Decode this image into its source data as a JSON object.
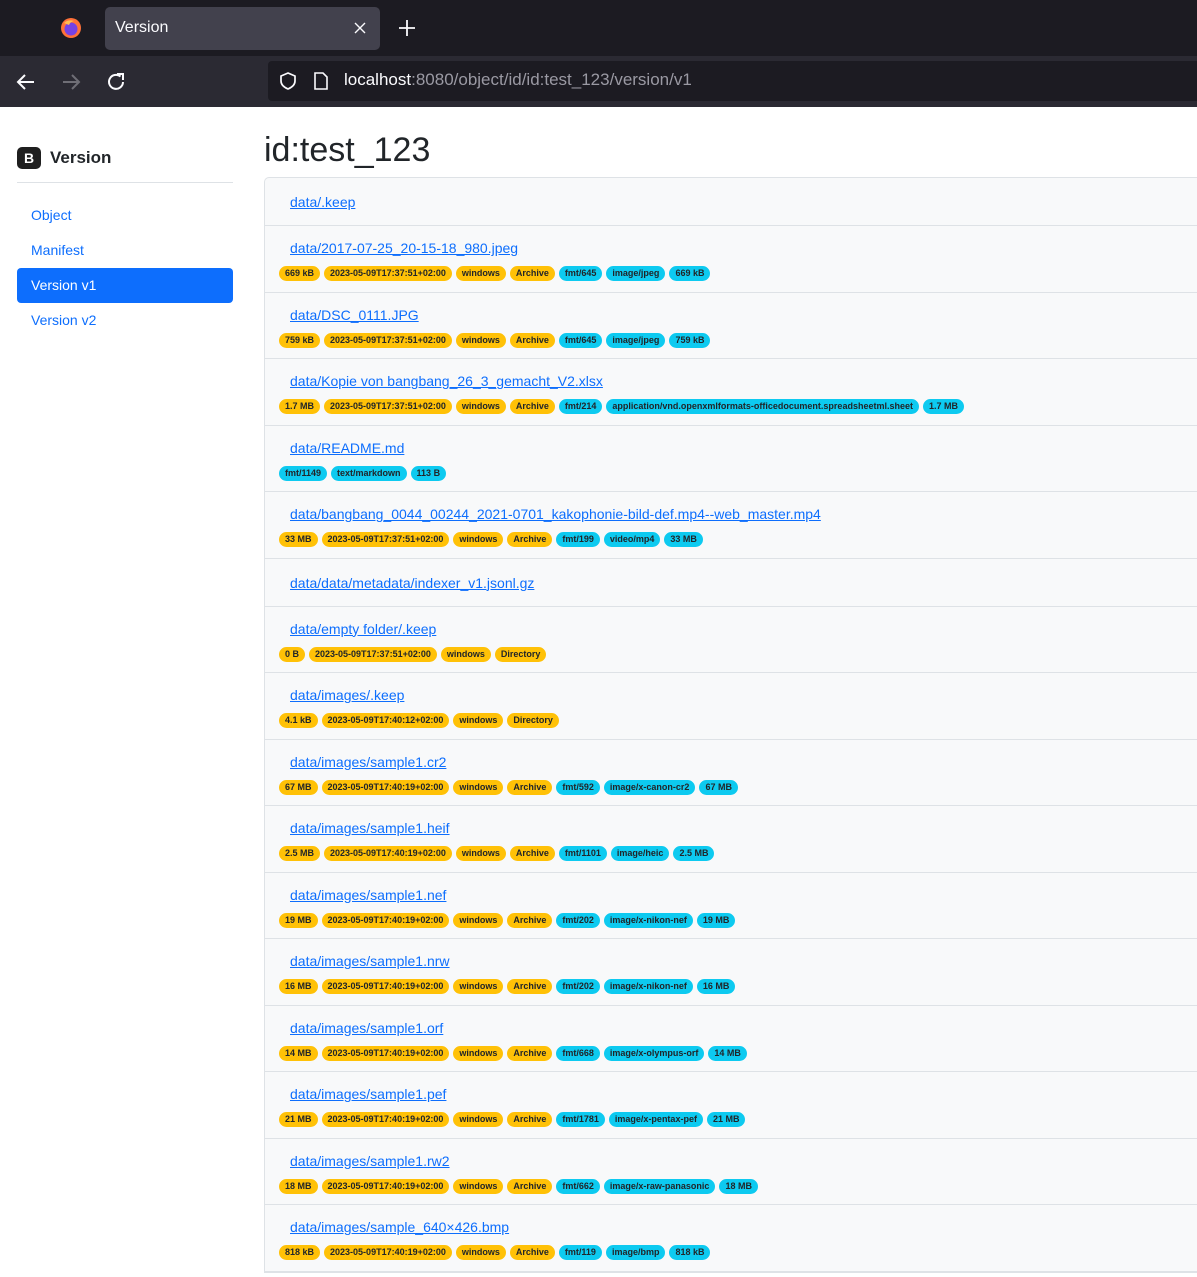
{
  "browser": {
    "tab_title": "Version",
    "url_host": "localhost",
    "url_path": ":8080/object/id/id:test_123/version/v1"
  },
  "sidebar": {
    "brand_letter": "B",
    "brand_title": "Version",
    "items": [
      {
        "label": "Object",
        "active": false
      },
      {
        "label": "Manifest",
        "active": false
      },
      {
        "label": "Version v1",
        "active": true
      },
      {
        "label": "Version v2",
        "active": false
      }
    ]
  },
  "main": {
    "title": "id:test_123",
    "files": [
      {
        "path": "data/.keep",
        "badges": []
      },
      {
        "path": "data/2017-07-25_20-15-18_980.jpeg",
        "badges": [
          {
            "text": "669 kB",
            "kind": "warn"
          },
          {
            "text": "2023-05-09T17:37:51+02:00",
            "kind": "warn"
          },
          {
            "text": "windows",
            "kind": "warn"
          },
          {
            "text": "Archive",
            "kind": "warn"
          },
          {
            "text": "fmt/645",
            "kind": "info"
          },
          {
            "text": "image/jpeg",
            "kind": "info"
          },
          {
            "text": "669 kB",
            "kind": "info"
          }
        ]
      },
      {
        "path": "data/DSC_0111.JPG",
        "badges": [
          {
            "text": "759 kB",
            "kind": "warn"
          },
          {
            "text": "2023-05-09T17:37:51+02:00",
            "kind": "warn"
          },
          {
            "text": "windows",
            "kind": "warn"
          },
          {
            "text": "Archive",
            "kind": "warn"
          },
          {
            "text": "fmt/645",
            "kind": "info"
          },
          {
            "text": "image/jpeg",
            "kind": "info"
          },
          {
            "text": "759 kB",
            "kind": "info"
          }
        ]
      },
      {
        "path": "data/Kopie von bangbang_26_3_gemacht_V2.xlsx",
        "badges": [
          {
            "text": "1.7 MB",
            "kind": "warn"
          },
          {
            "text": "2023-05-09T17:37:51+02:00",
            "kind": "warn"
          },
          {
            "text": "windows",
            "kind": "warn"
          },
          {
            "text": "Archive",
            "kind": "warn"
          },
          {
            "text": "fmt/214",
            "kind": "info"
          },
          {
            "text": "application/vnd.openxmlformats-officedocument.spreadsheetml.sheet",
            "kind": "info"
          },
          {
            "text": "1.7 MB",
            "kind": "info"
          }
        ]
      },
      {
        "path": "data/README.md",
        "badges": [
          {
            "text": "fmt/1149",
            "kind": "info"
          },
          {
            "text": "text/markdown",
            "kind": "info"
          },
          {
            "text": "113 B",
            "kind": "info"
          }
        ]
      },
      {
        "path": "data/bangbang_0044_00244_2021-0701_kakophonie-bild-def.mp4--web_master.mp4",
        "badges": [
          {
            "text": "33 MB",
            "kind": "warn"
          },
          {
            "text": "2023-05-09T17:37:51+02:00",
            "kind": "warn"
          },
          {
            "text": "windows",
            "kind": "warn"
          },
          {
            "text": "Archive",
            "kind": "warn"
          },
          {
            "text": "fmt/199",
            "kind": "info"
          },
          {
            "text": "video/mp4",
            "kind": "info"
          },
          {
            "text": "33 MB",
            "kind": "info"
          }
        ]
      },
      {
        "path": "data/data/metadata/indexer_v1.jsonl.gz",
        "badges": []
      },
      {
        "path": "data/empty folder/.keep",
        "badges": [
          {
            "text": "0 B",
            "kind": "warn"
          },
          {
            "text": "2023-05-09T17:37:51+02:00",
            "kind": "warn"
          },
          {
            "text": "windows",
            "kind": "warn"
          },
          {
            "text": "Directory",
            "kind": "warn"
          }
        ]
      },
      {
        "path": "data/images/.keep",
        "badges": [
          {
            "text": "4.1 kB",
            "kind": "warn"
          },
          {
            "text": "2023-05-09T17:40:12+02:00",
            "kind": "warn"
          },
          {
            "text": "windows",
            "kind": "warn"
          },
          {
            "text": "Directory",
            "kind": "warn"
          }
        ]
      },
      {
        "path": "data/images/sample1.cr2",
        "badges": [
          {
            "text": "67 MB",
            "kind": "warn"
          },
          {
            "text": "2023-05-09T17:40:19+02:00",
            "kind": "warn"
          },
          {
            "text": "windows",
            "kind": "warn"
          },
          {
            "text": "Archive",
            "kind": "warn"
          },
          {
            "text": "fmt/592",
            "kind": "info"
          },
          {
            "text": "image/x-canon-cr2",
            "kind": "info"
          },
          {
            "text": "67 MB",
            "kind": "info"
          }
        ]
      },
      {
        "path": "data/images/sample1.heif",
        "badges": [
          {
            "text": "2.5 MB",
            "kind": "warn"
          },
          {
            "text": "2023-05-09T17:40:19+02:00",
            "kind": "warn"
          },
          {
            "text": "windows",
            "kind": "warn"
          },
          {
            "text": "Archive",
            "kind": "warn"
          },
          {
            "text": "fmt/1101",
            "kind": "info"
          },
          {
            "text": "image/heic",
            "kind": "info"
          },
          {
            "text": "2.5 MB",
            "kind": "info"
          }
        ]
      },
      {
        "path": "data/images/sample1.nef",
        "badges": [
          {
            "text": "19 MB",
            "kind": "warn"
          },
          {
            "text": "2023-05-09T17:40:19+02:00",
            "kind": "warn"
          },
          {
            "text": "windows",
            "kind": "warn"
          },
          {
            "text": "Archive",
            "kind": "warn"
          },
          {
            "text": "fmt/202",
            "kind": "info"
          },
          {
            "text": "image/x-nikon-nef",
            "kind": "info"
          },
          {
            "text": "19 MB",
            "kind": "info"
          }
        ]
      },
      {
        "path": "data/images/sample1.nrw",
        "badges": [
          {
            "text": "16 MB",
            "kind": "warn"
          },
          {
            "text": "2023-05-09T17:40:19+02:00",
            "kind": "warn"
          },
          {
            "text": "windows",
            "kind": "warn"
          },
          {
            "text": "Archive",
            "kind": "warn"
          },
          {
            "text": "fmt/202",
            "kind": "info"
          },
          {
            "text": "image/x-nikon-nef",
            "kind": "info"
          },
          {
            "text": "16 MB",
            "kind": "info"
          }
        ]
      },
      {
        "path": "data/images/sample1.orf",
        "badges": [
          {
            "text": "14 MB",
            "kind": "warn"
          },
          {
            "text": "2023-05-09T17:40:19+02:00",
            "kind": "warn"
          },
          {
            "text": "windows",
            "kind": "warn"
          },
          {
            "text": "Archive",
            "kind": "warn"
          },
          {
            "text": "fmt/668",
            "kind": "info"
          },
          {
            "text": "image/x-olympus-orf",
            "kind": "info"
          },
          {
            "text": "14 MB",
            "kind": "info"
          }
        ]
      },
      {
        "path": "data/images/sample1.pef",
        "badges": [
          {
            "text": "21 MB",
            "kind": "warn"
          },
          {
            "text": "2023-05-09T17:40:19+02:00",
            "kind": "warn"
          },
          {
            "text": "windows",
            "kind": "warn"
          },
          {
            "text": "Archive",
            "kind": "warn"
          },
          {
            "text": "fmt/1781",
            "kind": "info"
          },
          {
            "text": "image/x-pentax-pef",
            "kind": "info"
          },
          {
            "text": "21 MB",
            "kind": "info"
          }
        ]
      },
      {
        "path": "data/images/sample1.rw2",
        "badges": [
          {
            "text": "18 MB",
            "kind": "warn"
          },
          {
            "text": "2023-05-09T17:40:19+02:00",
            "kind": "warn"
          },
          {
            "text": "windows",
            "kind": "warn"
          },
          {
            "text": "Archive",
            "kind": "warn"
          },
          {
            "text": "fmt/662",
            "kind": "info"
          },
          {
            "text": "image/x-raw-panasonic",
            "kind": "info"
          },
          {
            "text": "18 MB",
            "kind": "info"
          }
        ]
      },
      {
        "path": "data/images/sample_640×426.bmp",
        "badges": [
          {
            "text": "818 kB",
            "kind": "warn"
          },
          {
            "text": "2023-05-09T17:40:19+02:00",
            "kind": "warn"
          },
          {
            "text": "windows",
            "kind": "warn"
          },
          {
            "text": "Archive",
            "kind": "warn"
          },
          {
            "text": "fmt/119",
            "kind": "info"
          },
          {
            "text": "image/bmp",
            "kind": "info"
          },
          {
            "text": "818 kB",
            "kind": "info"
          }
        ]
      }
    ]
  },
  "colors": {
    "primary": "#0d6efd",
    "badge_warning": "#ffc107",
    "badge_info": "#0dcaf0",
    "chrome_dark": "#1c1b22",
    "chrome_nav": "#2b2a33"
  }
}
